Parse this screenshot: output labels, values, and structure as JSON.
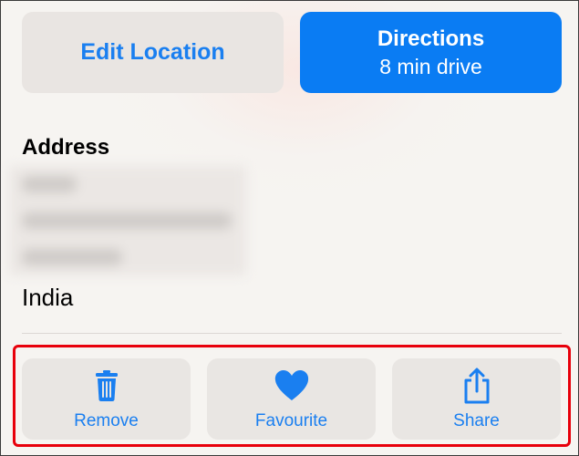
{
  "buttons": {
    "edit_location": "Edit Location",
    "directions_title": "Directions",
    "directions_subtitle": "8 min drive"
  },
  "address": {
    "heading": "Address",
    "country": "India"
  },
  "actions": [
    {
      "label": "Remove",
      "icon": "trash-icon"
    },
    {
      "label": "Favourite",
      "icon": "heart-icon"
    },
    {
      "label": "Share",
      "icon": "share-icon"
    }
  ],
  "colors": {
    "accent": "#1a7ff0",
    "primary_button": "#0a7cf3",
    "highlight_border": "#e8000b"
  }
}
